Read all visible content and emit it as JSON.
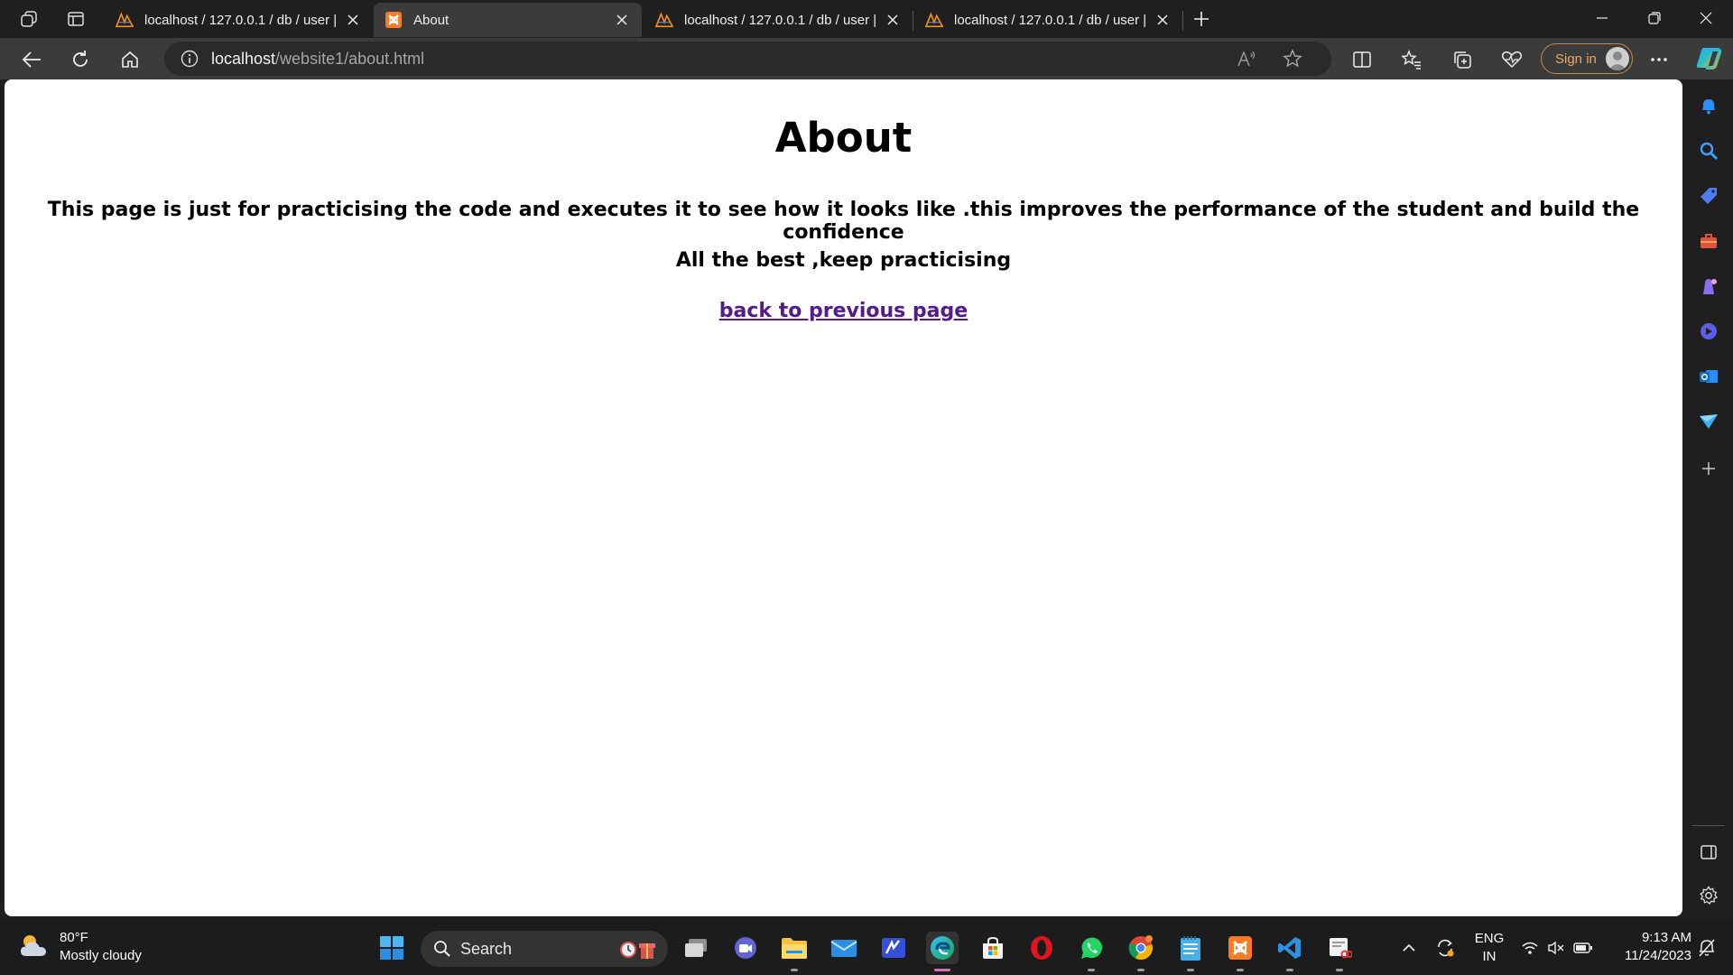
{
  "browser": {
    "tabs": [
      {
        "title": "localhost / 127.0.0.1 / db / user |",
        "favicon": "phpmyadmin-icon",
        "active": false
      },
      {
        "title": "About",
        "favicon": "xampp-icon",
        "active": true
      },
      {
        "title": "localhost / 127.0.0.1 / db / user |",
        "favicon": "phpmyadmin-icon",
        "active": false
      },
      {
        "title": "localhost / 127.0.0.1 / db / user |",
        "favicon": "phpmyadmin-icon",
        "active": false
      }
    ],
    "address": {
      "host": "localhost",
      "path": "/website1/about.html"
    },
    "sign_in_label": "Sign in"
  },
  "page": {
    "heading": "About",
    "paragraph1": "This page is just for practicising the code and executes it to see how it looks like .this improves the performance of the student and build the confidence",
    "paragraph2": "All the best ,keep practicising",
    "back_link": "back to previous page"
  },
  "taskbar": {
    "weather": {
      "temp": "80°F",
      "condition": "Mostly cloudy"
    },
    "search_label": "Search",
    "language": {
      "line1": "ENG",
      "line2": "IN"
    },
    "clock": {
      "time": "9:13 AM",
      "date": "11/24/2023"
    }
  },
  "colors": {
    "accent_link": "#551a8b",
    "signin_border": "#c28a4e",
    "edge_active_indicator": "#d472b8"
  }
}
